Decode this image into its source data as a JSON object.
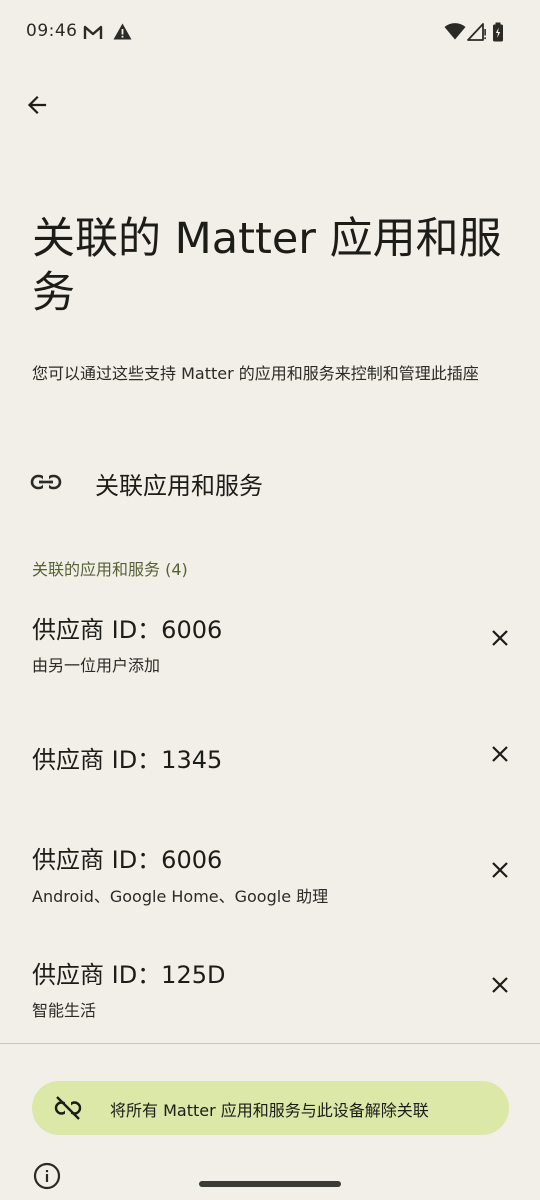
{
  "status_bar": {
    "time": "09:46",
    "icons": [
      "gmail-icon",
      "alert-icon",
      "wifi-icon",
      "signal-icon",
      "battery-icon"
    ]
  },
  "header": {
    "back_icon": "arrow-back-icon",
    "title": "关联的 Matter 应用和服务"
  },
  "description": "您可以通过这些支持 Matter 的应用和服务来控制和管理此插座",
  "link_action": {
    "icon": "link-icon",
    "label": "关联应用和服务"
  },
  "linked_section": {
    "header": "关联的应用和服务 (4)",
    "items": [
      {
        "title": "供应商 ID：6006",
        "subtitle": "由另一位用户添加"
      },
      {
        "title": "供应商 ID：1345",
        "subtitle": ""
      },
      {
        "title": "供应商 ID：6006",
        "subtitle": "Android、Google Home、Google 助理"
      },
      {
        "title": "供应商 ID：125D",
        "subtitle": "智能生活"
      }
    ]
  },
  "unlink_button": {
    "icon": "link-off-icon",
    "label": "将所有 Matter 应用和服务与此设备解除关联"
  },
  "footer": {
    "info_icon": "info-icon"
  },
  "colors": {
    "background": "#f2efe9",
    "accent_text": "#566232",
    "button_bg": "#dce8a8"
  }
}
